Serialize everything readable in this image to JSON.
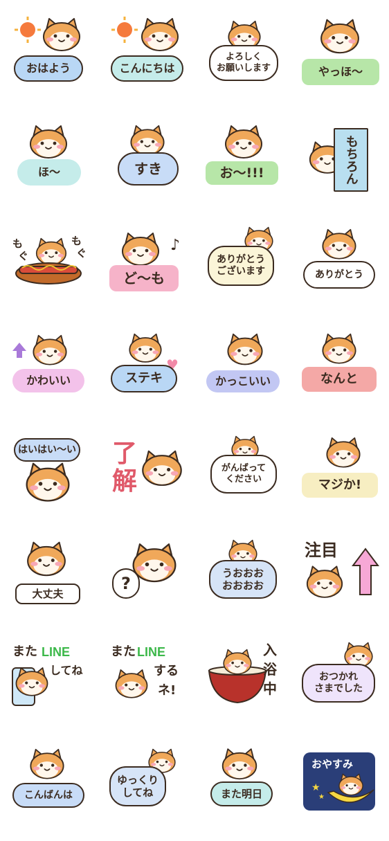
{
  "stickers": [
    {
      "text": "おはよう",
      "bg": "#b9d7f5",
      "extras": []
    },
    {
      "text": "こんにちは",
      "bg": "#c5ecea",
      "extras": []
    },
    {
      "text": "よろしく\nお願いします",
      "bg": "#ffffff",
      "extras": []
    },
    {
      "text": "やっほ〜",
      "bg": "#b7e6a8",
      "extras": []
    },
    {
      "text": "ほ〜",
      "bg": "#c5ecea",
      "extras": []
    },
    {
      "text": "すき",
      "bg": "#c8dcf7",
      "extras": []
    },
    {
      "text": "お〜!!!",
      "bg": "#b7e6a8",
      "extras": []
    },
    {
      "text": "もちろん",
      "bg": "#b9dff0",
      "extras": []
    },
    {
      "text": "",
      "bg": "#ffffff",
      "extras": [
        "も",
        "ぐ",
        "も",
        "ぐ"
      ]
    },
    {
      "text": "ど〜も",
      "bg": "#f6b3c9",
      "extras": []
    },
    {
      "text": "ありがとう\nございます",
      "bg": "#fbf5d8",
      "extras": []
    },
    {
      "text": "ありがとう",
      "bg": "#ffffff",
      "extras": []
    },
    {
      "text": "かわいい",
      "bg": "#f3c2ea",
      "extras": []
    },
    {
      "text": "ステキ",
      "bg": "#b9d7f5",
      "extras": []
    },
    {
      "text": "かっこいい",
      "bg": "#c2c7f3",
      "extras": []
    },
    {
      "text": "なんと",
      "bg": "#f4a8a6",
      "extras": []
    },
    {
      "text": "はいはい〜い",
      "bg": "#c8dcf7",
      "extras": []
    },
    {
      "text": "",
      "bg": "#ffffff",
      "extras": [
        "了",
        "解"
      ]
    },
    {
      "text": "がんばって\nください",
      "bg": "#ffffff",
      "extras": []
    },
    {
      "text": "マジか!",
      "bg": "#f7eec2",
      "extras": []
    },
    {
      "text": "大丈夫",
      "bg": "#ffffff",
      "extras": []
    },
    {
      "text": "?",
      "bg": "#ffffff",
      "extras": []
    },
    {
      "text": "うおおお\nおおおお",
      "bg": "#d6e4f7",
      "extras": []
    },
    {
      "text": "",
      "bg": "#ffffff",
      "extras": [
        "注目"
      ]
    },
    {
      "text": "",
      "bg": "#ffffff",
      "extras": [
        "また",
        "LINE",
        "してね"
      ]
    },
    {
      "text": "",
      "bg": "#ffffff",
      "extras": [
        "また",
        "LINE",
        "する",
        "ネ!"
      ]
    },
    {
      "text": "",
      "bg": "#ffffff",
      "extras": [
        "入",
        "浴",
        "中"
      ]
    },
    {
      "text": "おつかれ\nさまでした",
      "bg": "#efe4fb",
      "extras": []
    },
    {
      "text": "こんばんは",
      "bg": "#c8dcf7",
      "extras": []
    },
    {
      "text": "ゆっくり\nしてね",
      "bg": "#d6e4f7",
      "extras": []
    },
    {
      "text": "また明日",
      "bg": "#c5ecea",
      "extras": []
    },
    {
      "text": "おやすみ",
      "bg": "#2a3e78",
      "extras": []
    }
  ],
  "colors": {
    "fur": "#f0a85a",
    "fur_light": "#fff7ec",
    "outline": "#3b2b20",
    "blush": "#f7a7b5",
    "line_green": "#3cb84a",
    "arrow_pink": "#f7a8d6",
    "arrow_purple": "#a97ad9"
  }
}
